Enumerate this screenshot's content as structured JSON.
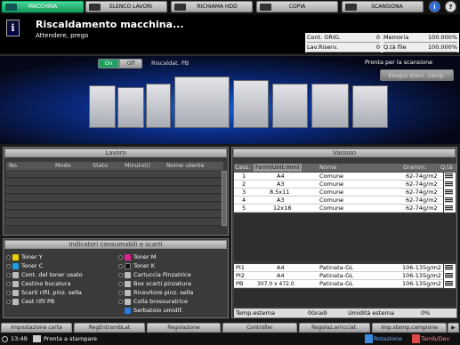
{
  "tabs": [
    {
      "label": "MACCHINA",
      "active": true
    },
    {
      "label": "ELENCO LAVORI",
      "active": false
    },
    {
      "label": "RICHIAMA HDD",
      "active": false
    },
    {
      "label": "COPIA",
      "active": false
    },
    {
      "label": "SCANSIONA",
      "active": false
    }
  ],
  "header_buttons": {
    "help": "?",
    "guide": "i"
  },
  "message": {
    "icon": "info-icon",
    "icon_glyph": "i",
    "title": "Riscaldamento macchina...",
    "subtitle": "Attendere, prego"
  },
  "counters": {
    "orig_label": "Cont. ORIG.",
    "orig_value": "0",
    "memory_label": "Memoria",
    "memory_value": "100.000%",
    "reserve_label": "Lav.Riserv.",
    "reserve_value": "0",
    "file_label": "Q.tà file",
    "file_value": "100.000%"
  },
  "machine": {
    "on_label": "On",
    "off_label": "Off",
    "preheat_label": "Riscaldat. PB",
    "status": "Pronta per la scansione",
    "scan_button": "Esegui stam. camp."
  },
  "lavoro": {
    "title": "Lavoro",
    "columns": [
      "No.",
      "Modo",
      "Stato",
      "Minuto(i)",
      "Nome utente"
    ]
  },
  "consumabili": {
    "title": "Indicatori consumabili e scarti",
    "left": [
      "Toner Y",
      "Toner C",
      "Cont. del toner usato",
      "Cestino bucatura",
      "Scarti rifil. pinz. sella",
      "Cest rifil PB"
    ],
    "right": [
      "Toner M",
      "Toner K",
      "Cartuccia Pinzatrice",
      "Box scarti pinzatura",
      "Ricevitore pinz. sella",
      "Colla brossuratrice",
      "Serbatoio umidif."
    ]
  },
  "vassoio": {
    "title": "Vassoio",
    "columns": [
      "Cass.",
      "Form(Unit:mm)",
      "Nome",
      "Gramm.",
      "Q.tà"
    ],
    "rows": [
      {
        "tray": "1",
        "format": "A4",
        "name": "Comune",
        "weight": "62-74g/m2"
      },
      {
        "tray": "2",
        "format": "A3",
        "name": "Comune",
        "weight": "62-74g/m2"
      },
      {
        "tray": "3",
        "format": "8.5x11",
        "name": "Comune",
        "weight": "62-74g/m2"
      },
      {
        "tray": "4",
        "format": "A3",
        "name": "Comune",
        "weight": "62-74g/m2"
      },
      {
        "tray": "5",
        "format": "12x18",
        "name": "Comune",
        "weight": "62-74g/m2"
      }
    ],
    "extra_rows": [
      {
        "tray": "PI1",
        "format": "A4",
        "name": "Patinata-GL",
        "weight": "106-135g/m2"
      },
      {
        "tray": "PI2",
        "format": "A4",
        "name": "Patinata-GL",
        "weight": "106-135g/m2"
      },
      {
        "tray": "PB",
        "format": "307.0 x 472.0",
        "name": "Patinata-GL",
        "weight": "106-135g/m2"
      }
    ],
    "temp_label": "Temp.esterna",
    "temp_value": "0Gradi",
    "humidity_label": "Umidità esterna",
    "humidity_value": "0%"
  },
  "bottom_tabs": [
    "Impostazione carta",
    "RegEntrambLat",
    "Regolazione",
    "Controller",
    "Regolaz.arricciat.",
    "Imp.stamp.campione"
  ],
  "status": {
    "time": "13:49",
    "message": "Pronta a stampare",
    "rotation": "Rotazione",
    "tamb": "Tamb/Dev"
  },
  "colors": {
    "accent": "#1fb874",
    "panel": "#3a3a3a"
  }
}
